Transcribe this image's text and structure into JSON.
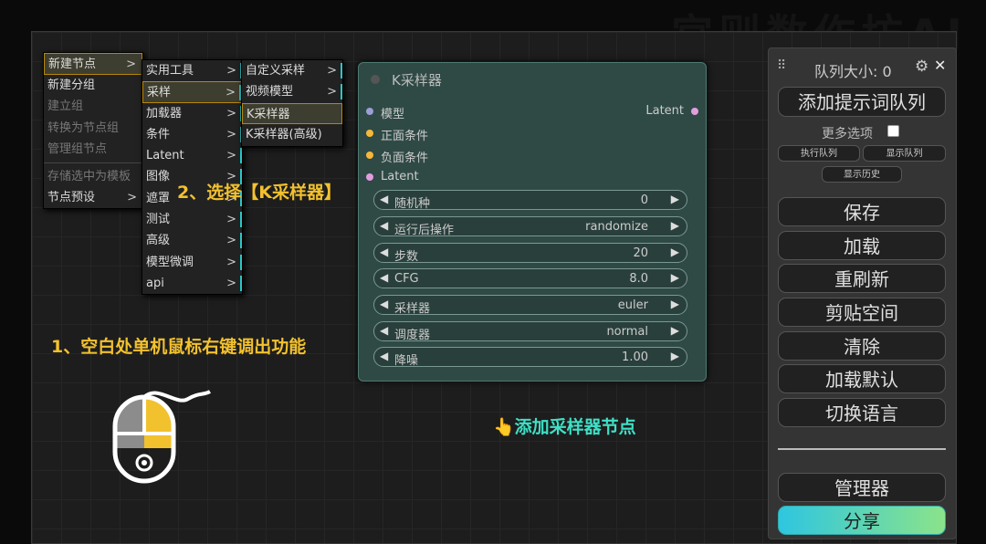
{
  "watermark": "宫则数作坊AI",
  "menu_main": {
    "items": [
      {
        "label": "新建节点",
        "arrow": ">"
      },
      {
        "label": "新建分组"
      },
      {
        "label": "建立组"
      },
      {
        "label": "转换为节点组"
      },
      {
        "label": "管理组节点"
      },
      {
        "label": "存储选中为模板"
      },
      {
        "label": "节点预设",
        "arrow": ">"
      }
    ]
  },
  "menu_category": {
    "items": [
      {
        "label": "实用工具"
      },
      {
        "label": "采样"
      },
      {
        "label": "加载器"
      },
      {
        "label": "条件"
      },
      {
        "label": "Latent"
      },
      {
        "label": "图像"
      },
      {
        "label": "遮罩"
      },
      {
        "label": "测试"
      },
      {
        "label": "高级"
      },
      {
        "label": "模型微调"
      },
      {
        "label": "api"
      }
    ],
    "arrow": ">"
  },
  "menu_sampling": {
    "items": [
      {
        "label": "自定义采样",
        "arrow": ">"
      },
      {
        "label": "视频模型",
        "arrow": ">"
      },
      {
        "label": "K采样器"
      },
      {
        "label": "K采样器(高级)"
      }
    ]
  },
  "node": {
    "title": "K采样器",
    "inputs": [
      {
        "label": "模型",
        "color": "#9b9fd6"
      },
      {
        "label": "正面条件",
        "color": "#f5b93a"
      },
      {
        "label": "负面条件",
        "color": "#f5b93a"
      },
      {
        "label": "Latent",
        "color": "#e29de0"
      }
    ],
    "output": {
      "label": "Latent",
      "color": "#e29de0"
    },
    "widgets": [
      {
        "label": "随机种",
        "value": "0"
      },
      {
        "label": "运行后操作",
        "value": "randomize"
      },
      {
        "label": "步数",
        "value": "20"
      },
      {
        "label": "CFG",
        "value": "8.0"
      },
      {
        "label": "采样器",
        "value": "euler"
      },
      {
        "label": "调度器",
        "value": "normal"
      },
      {
        "label": "降噪",
        "value": "1.00"
      }
    ],
    "left_arrow": "◀",
    "right_arrow": "▶"
  },
  "annotations": {
    "step1": "1、空白处单机鼠标右键调出功能",
    "step2": "2、选择【K采样器】",
    "add_node": "添加采样器节点",
    "pointer": "👆"
  },
  "sidebar": {
    "queue_size": "队列大小: 0",
    "drag_handle": "⠿",
    "settings_icon": "⚙",
    "close_icon": "✕",
    "add_prompt_queue": "添加提示词队列",
    "more_options": "更多选项",
    "run_queue": "执行队列",
    "show_queue": "显示队列",
    "show_history": "显示历史",
    "save": "保存",
    "load": "加载",
    "refresh": "重刷新",
    "clipspace": "剪贴空间",
    "clear": "清除",
    "load_default": "加载默认",
    "switch_language": "切换语言",
    "manager": "管理器",
    "share": "分享"
  }
}
